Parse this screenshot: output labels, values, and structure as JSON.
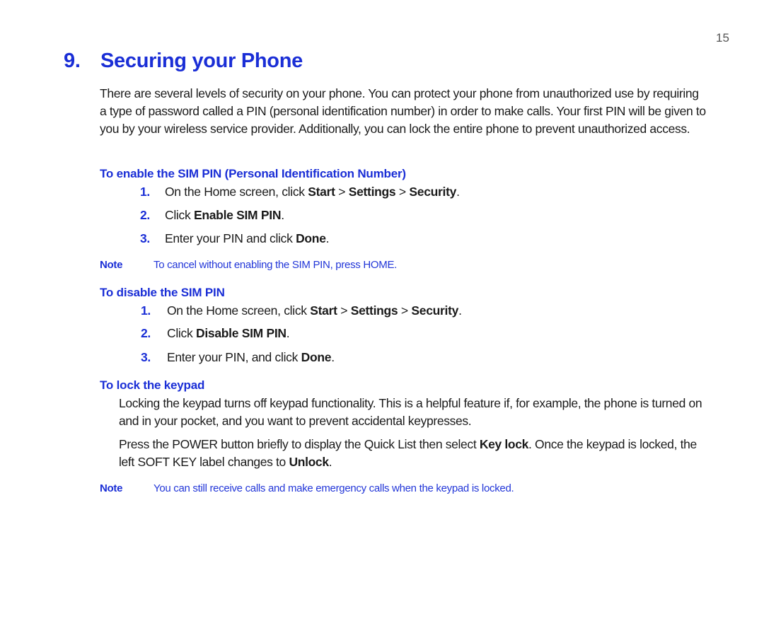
{
  "page_number": "15",
  "title": {
    "number": "9.",
    "text": "Securing your Phone"
  },
  "intro": "There are several levels of security on your phone. You can protect your phone from unauthorized use by requiring a type of password called a PIN (personal identification number) in order to make calls. Your first PIN will be given to you by your wireless service provider. Additionally, you can lock the entire phone to prevent unauthorized access.",
  "sections": [
    {
      "heading": "To enable the SIM PIN (Personal Identification Number)",
      "steps": [
        {
          "num": "1.",
          "pre": "On the Home screen, click ",
          "b1": "Start",
          "s1": " > ",
          "b2": "Settings",
          "s2": " > ",
          "b3": "Security",
          "post": "."
        },
        {
          "num": "2.",
          "pre": "Click ",
          "b1": "Enable SIM PIN",
          "post": "."
        },
        {
          "num": "3.",
          "pre": "Enter your PIN and click ",
          "b1": "Done",
          "post": "."
        }
      ],
      "note": {
        "label": "Note",
        "text": "To cancel without enabling the SIM PIN, press HOME."
      }
    },
    {
      "heading": "To disable the SIM PIN",
      "steps": [
        {
          "num": "1.",
          "pre": "On the Home screen, click ",
          "b1": "Start",
          "s1": " > ",
          "b2": "Settings",
          "s2": " > ",
          "b3": "Security",
          "post": "."
        },
        {
          "num": "2.",
          "pre": "Click ",
          "b1": "Disable SIM PIN",
          "post": "."
        },
        {
          "num": "3.",
          "pre": "Enter your PIN, and click ",
          "b1": "Done",
          "post": "."
        }
      ]
    },
    {
      "heading": "To lock the keypad",
      "para1": "Locking the keypad turns off keypad functionality. This is a helpful feature if, for example, the phone is turned on and in your pocket, and you want to prevent accidental keypresses.",
      "para2": {
        "pre": "Press the POWER button briefly to display the Quick List then select ",
        "b1": "Key lock",
        "mid": ". Once the keypad is locked, the left SOFT KEY label changes to ",
        "b2": "Unlock",
        "post": "."
      },
      "note": {
        "label": "Note",
        "text": "You can still receive calls and make emergency calls when the keypad is locked."
      }
    }
  ],
  "colors": {
    "heading_blue": "#1a2ed6",
    "note_blue": "#2236d8",
    "body_text": "#1a1a1a"
  }
}
